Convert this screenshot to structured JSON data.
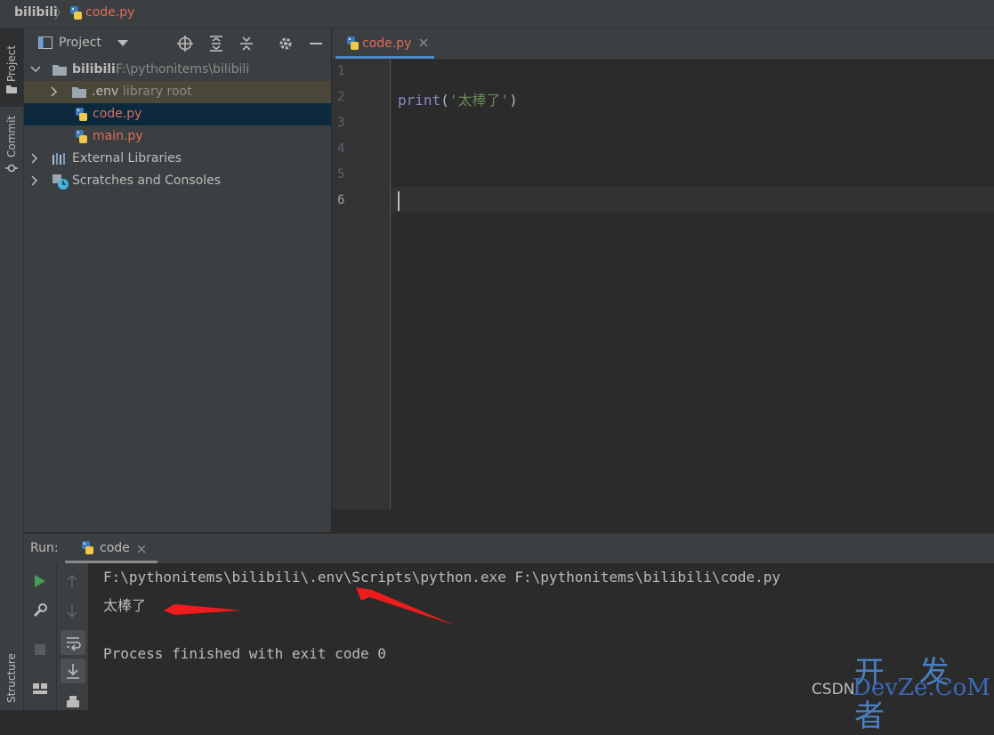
{
  "breadcrumb": {
    "project": "bilibili",
    "file": "code.py"
  },
  "toolstrip": {
    "project": "Project",
    "commit": "Commit",
    "structure": "Structure"
  },
  "project_panel": {
    "title": "Project",
    "tree": [
      {
        "label": "bilibili",
        "hint": "F:\\pythonitems\\bilibili"
      },
      {
        "label": ".env",
        "hint": "library root"
      },
      {
        "label": "code.py"
      },
      {
        "label": "main.py"
      },
      {
        "label": "External Libraries"
      },
      {
        "label": "Scratches and Consoles"
      }
    ]
  },
  "editor": {
    "tab_label": "code.py",
    "line_numbers": [
      "1",
      "2",
      "3",
      "4",
      "5",
      "6"
    ],
    "code": {
      "func": "print",
      "open": "(",
      "string": "'太棒了'",
      "close": ")"
    }
  },
  "run": {
    "label": "Run:",
    "tab_label": "code",
    "console": [
      "F:\\pythonitems\\bilibili\\.env\\Scripts\\python.exe F:\\pythonitems\\bilibili\\code.py",
      "太棒了",
      "Process finished with exit code 0"
    ]
  },
  "watermark": {
    "top": "开 发 者",
    "csdn": "CSDN",
    "bottom": "DevZe.CoM"
  },
  "colors": {
    "accent": "#4a88c7",
    "file_red": "#e06c5b",
    "arrow_red": "#ee1c1c",
    "run_green": "#499c54"
  }
}
